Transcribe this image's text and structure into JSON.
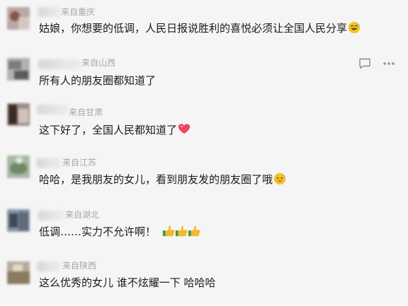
{
  "comments": [
    {
      "location": "来自重庆",
      "text": "姑娘，你想要的低调，人民日报说胜利的喜悦必须让全国人民分享",
      "emoji": "grinning-sweat-emoji"
    },
    {
      "location": "来自山西",
      "text": "所有人的朋友圈都知道了",
      "emoji": ""
    },
    {
      "location": "来自甘肃",
      "text": "这下好了，全国人民都知道了",
      "emoji": "heart-emoji"
    },
    {
      "location": "来自江苏",
      "text": "哈哈，是我朋友的女儿，看到朋友发的朋友圈了哦",
      "emoji": "embarrassed-emoji"
    },
    {
      "location": "来自湖北",
      "text": "低调……实力不允许啊！",
      "emoji": "thumbs-up-emoji-x3"
    },
    {
      "location": "来自陕西",
      "text": "这么优秀的女儿 谁不炫耀一下 哈哈哈",
      "emoji": ""
    }
  ],
  "actions": {
    "reply_icon": "reply-comment-icon",
    "more_icon": "more-options-icon"
  },
  "colors": {
    "background": "#f5f5f5",
    "text": "#1a1a1a",
    "location": "#a6a6a6",
    "heart": "#ec4663",
    "thumb": "#f4b829"
  }
}
